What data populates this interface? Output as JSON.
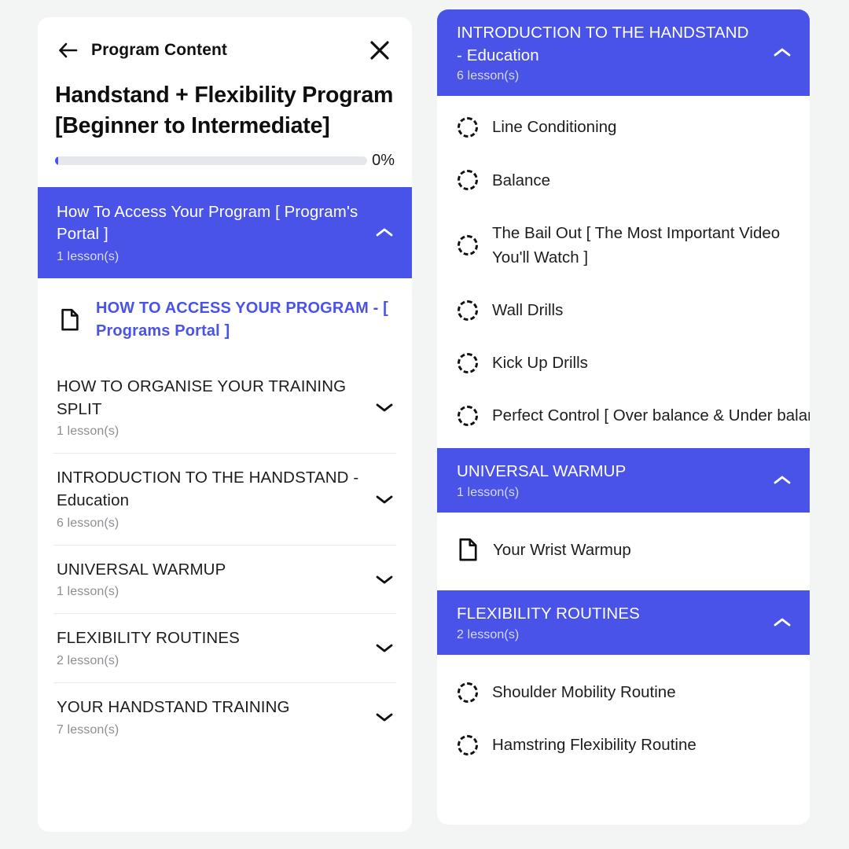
{
  "theme": {
    "accent": "#4a53e8",
    "page_bg": "#f3f4f4",
    "card_bg": "#ffffff",
    "muted_text": "#8d8d93"
  },
  "left_panel": {
    "header": {
      "back_icon": "arrow-left-icon",
      "title": "Program Content",
      "close_icon": "close-icon"
    },
    "program_title": "Handstand + Flexibility Program [Beginner to Intermediate]",
    "progress": {
      "percent_label": "0%",
      "percent_value": 0
    },
    "sections": [
      {
        "name": "How To Access Your Program [ Program's Portal ]",
        "count": "1 lesson(s)",
        "state": "expanded",
        "chevron": "chevron-up-icon",
        "lessons": [
          {
            "label": "HOW TO ACCESS YOUR PROGRAM - [ Programs Portal ]",
            "icon": "document-icon",
            "style": "link"
          }
        ]
      },
      {
        "name": "HOW TO ORGANISE YOUR TRAINING SPLIT",
        "count": "1 lesson(s)",
        "state": "collapsed",
        "chevron": "chevron-down-icon",
        "lessons": []
      },
      {
        "name": "INTRODUCTION TO THE HANDSTAND - Education",
        "count": "6 lesson(s)",
        "state": "collapsed",
        "chevron": "chevron-down-icon",
        "lessons": []
      },
      {
        "name": "UNIVERSAL WARMUP",
        "count": "1 lesson(s)",
        "state": "collapsed",
        "chevron": "chevron-down-icon",
        "lessons": []
      },
      {
        "name": "FLEXIBILITY ROUTINES",
        "count": "2 lesson(s)",
        "state": "collapsed",
        "chevron": "chevron-down-icon",
        "lessons": []
      },
      {
        "name": "YOUR HANDSTAND TRAINING",
        "count": "7 lesson(s)",
        "state": "collapsed",
        "chevron": "chevron-down-icon",
        "lessons": []
      }
    ]
  },
  "right_panel": {
    "sections": [
      {
        "name": "INTRODUCTION TO THE HANDSTAND - Education",
        "count": "6 lesson(s)",
        "state": "expanded",
        "chevron": "chevron-up-icon",
        "lessons": [
          {
            "label": "Line Conditioning",
            "icon": "dashed-circle-icon"
          },
          {
            "label": "Balance",
            "icon": "dashed-circle-icon"
          },
          {
            "label": "The Bail Out [ The Most Important Video You'll Watch ]",
            "icon": "dashed-circle-icon"
          },
          {
            "label": "Wall Drills",
            "icon": "dashed-circle-icon"
          },
          {
            "label": "Kick Up Drills",
            "icon": "dashed-circle-icon"
          },
          {
            "label": "Perfect Control [ Over balance & Under balance ]",
            "icon": "dashed-circle-icon"
          }
        ]
      },
      {
        "name": "UNIVERSAL WARMUP",
        "count": "1 lesson(s)",
        "state": "expanded",
        "chevron": "chevron-up-icon",
        "lessons": [
          {
            "label": "Your Wrist Warmup",
            "icon": "document-icon"
          }
        ]
      },
      {
        "name": "FLEXIBILITY ROUTINES",
        "count": "2 lesson(s)",
        "state": "expanded",
        "chevron": "chevron-up-icon",
        "lessons": [
          {
            "label": "Shoulder Mobility Routine",
            "icon": "dashed-circle-icon"
          },
          {
            "label": "Hamstring Flexibility Routine",
            "icon": "dashed-circle-icon"
          }
        ]
      }
    ]
  }
}
